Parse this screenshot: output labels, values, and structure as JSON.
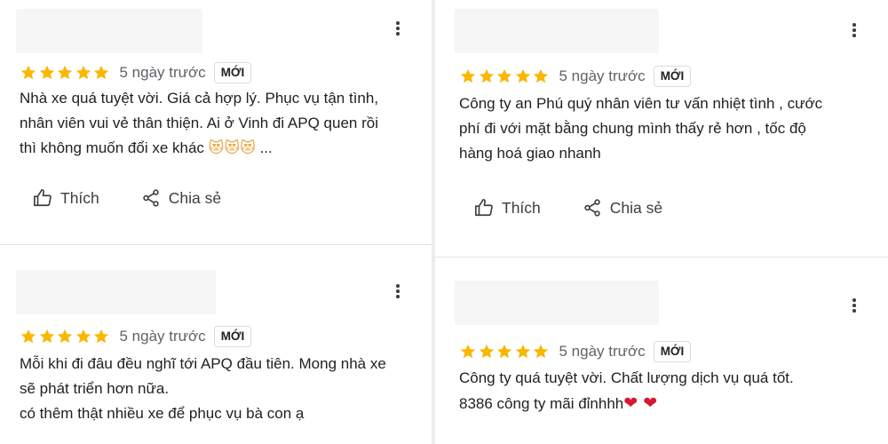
{
  "colors": {
    "star": "#F9B700",
    "accent_text": "#202124",
    "muted_text": "#5F6368",
    "heart": "#D6192F"
  },
  "reviews": [
    {
      "rating": 5,
      "date": "5 ngày trước",
      "badge": "MỚI",
      "lines": [
        "Nhà xe quá tuyệt vời. Giá cả hợp lý. Phục vụ tận tình,",
        "nhân viên vui vẻ thân thiện. Ai ở Vinh đi APQ quen rồi",
        "thì không muốn đổi xe khác"
      ],
      "emojis": "😻😻😻",
      "ellipsis": "...",
      "like_label": "Thích",
      "share_label": "Chia sẻ"
    },
    {
      "rating": 5,
      "date": "5 ngày trước",
      "badge": "MỚI",
      "lines": [
        "Công ty an Phú quý nhân viên tư vấn nhiệt tình , cước",
        "phí đi với mặt bằng chung mình thấy rẻ hơn , tốc độ",
        "hàng hoá giao nhanh"
      ],
      "like_label": "Thích",
      "share_label": "Chia sẻ"
    },
    {
      "rating": 5,
      "date": "5 ngày trước",
      "badge": "MỚI",
      "lines": [
        "Mỗi khi đi đâu đều nghĩ tới APQ đầu tiên. Mong nhà xe",
        "sẽ phát triển hơn nữa.",
        "có thêm thật nhiều xe để phục vụ bà con ạ"
      ]
    },
    {
      "rating": 5,
      "date": "5 ngày trước",
      "badge": "MỚI",
      "lines": [
        "Công ty quá tuyệt vời. Chất lượng dịch vụ quá tốt.",
        "8386 công ty mãi đỉnhhh"
      ],
      "hearts": "❤ ❤"
    }
  ],
  "icons": {
    "more": "more-vert-icon",
    "like": "thumb-up-icon",
    "share": "share-icon",
    "star": "star-icon"
  }
}
